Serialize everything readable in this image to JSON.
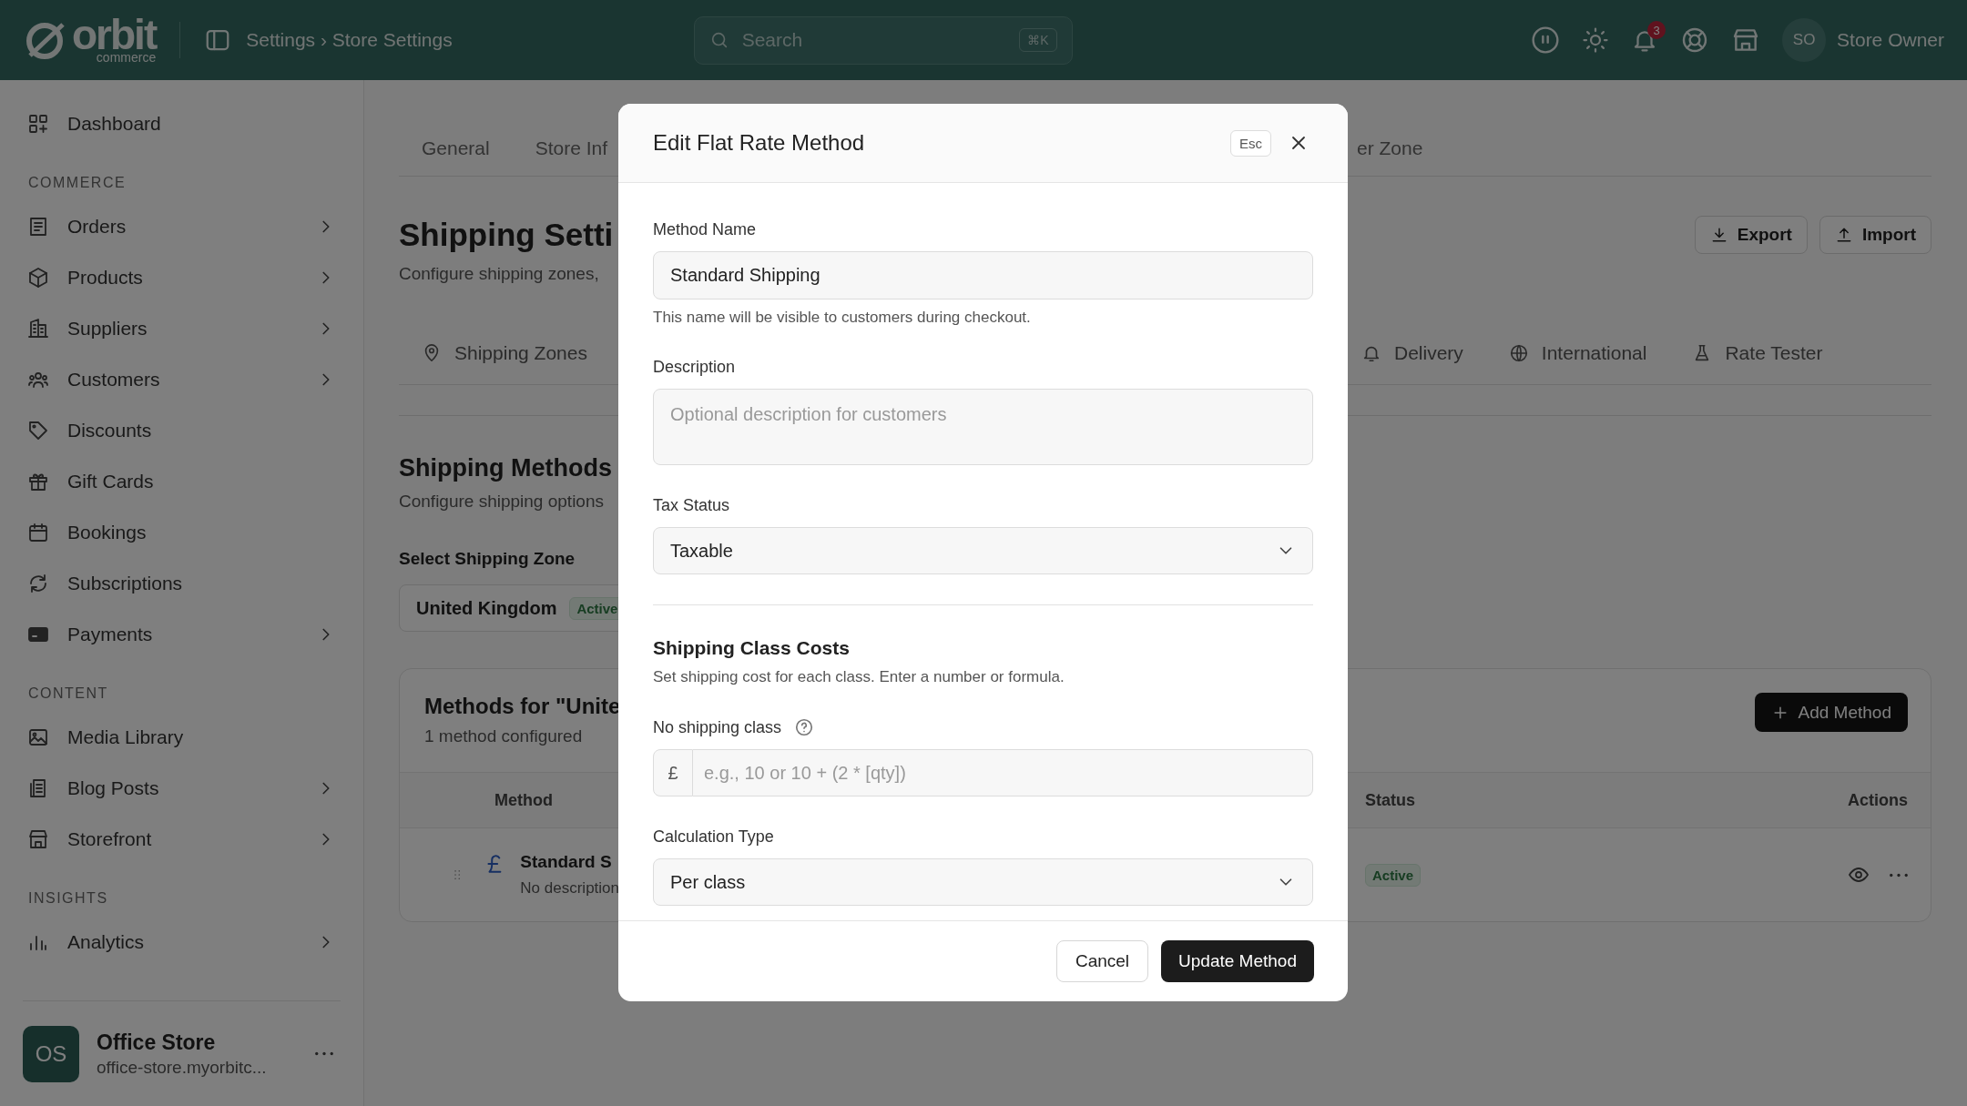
{
  "topbar": {
    "logo": "orbit",
    "logo_sub": "commerce",
    "breadcrumb": "Settings › Store Settings",
    "search": {
      "placeholder": "Search",
      "shortcut": "⌘K"
    },
    "notification_count": "3",
    "avatar": "SO",
    "user": "Store Owner"
  },
  "sidebar": {
    "sections": [
      {
        "items": [
          {
            "label": "Dashboard",
            "has_submenu": false
          }
        ]
      },
      {
        "title": "COMMERCE",
        "items": [
          {
            "label": "Orders",
            "has_submenu": true
          },
          {
            "label": "Products",
            "has_submenu": true
          },
          {
            "label": "Suppliers",
            "has_submenu": true
          },
          {
            "label": "Customers",
            "has_submenu": true
          },
          {
            "label": "Discounts",
            "has_submenu": false
          },
          {
            "label": "Gift Cards",
            "has_submenu": false
          },
          {
            "label": "Bookings",
            "has_submenu": false
          },
          {
            "label": "Subscriptions",
            "has_submenu": false
          },
          {
            "label": "Payments",
            "has_submenu": true
          }
        ]
      },
      {
        "title": "CONTENT",
        "items": [
          {
            "label": "Media Library",
            "has_submenu": false
          },
          {
            "label": "Blog Posts",
            "has_submenu": true
          },
          {
            "label": "Storefront",
            "has_submenu": true
          }
        ]
      },
      {
        "title": "INSIGHTS",
        "items": [
          {
            "label": "Analytics",
            "has_submenu": true
          }
        ]
      }
    ],
    "store": {
      "avatar": "OS",
      "name": "Office Store",
      "url": "office-store.myorbitc..."
    }
  },
  "tabs": [
    {
      "label": "General",
      "selected": false
    },
    {
      "label": "Store Inf",
      "selected": false
    },
    {
      "label": "er Zone",
      "selected": false
    }
  ],
  "header": {
    "title": "Shipping Setti",
    "subtitle": "Configure shipping zones,",
    "buttons": [
      "Export",
      "Import"
    ]
  },
  "subtabs": [
    {
      "label": "Shipping Zones",
      "selected": false
    },
    {
      "label": "Delivery",
      "selected": false
    },
    {
      "label": "International",
      "selected": false
    },
    {
      "label": "Rate Tester",
      "selected": false
    }
  ],
  "methods": {
    "title": "Shipping Methods",
    "subtitle": "Configure shipping options",
    "zone_label": "Select Shipping Zone",
    "zone": {
      "name": "United Kingdom",
      "badge": "Active"
    }
  },
  "card": {
    "title": "Methods for \"Unite",
    "subtitle": "1 method configured",
    "add_button": "Add Method",
    "columns": [
      "Method",
      "Status",
      "Actions"
    ],
    "rows": [
      {
        "name": "Standard S",
        "description": "No description",
        "status": "Active"
      }
    ]
  },
  "dialog": {
    "title": "Edit Flat Rate Method",
    "esc": "Esc",
    "fields": [
      {
        "kind": "text",
        "label": "Method Name",
        "value": "Standard Shipping",
        "hint": "This name will be visible to customers during checkout."
      },
      {
        "kind": "textarea",
        "label": "Description",
        "placeholder": "Optional description for customers"
      },
      {
        "kind": "select",
        "label": "Tax Status",
        "value": "Taxable"
      },
      {
        "kind": "section",
        "title": "Shipping Class Costs",
        "description": "Set shipping cost for each class. Enter a number or formula."
      },
      {
        "kind": "prefixed",
        "label": "No shipping class",
        "prefix": "£",
        "placeholder": "e.g., 10 or 10 + (2 * [qty])"
      },
      {
        "kind": "select",
        "label": "Calculation Type",
        "value": "Per class"
      }
    ],
    "cancel": "Cancel",
    "submit": "Update Method"
  }
}
